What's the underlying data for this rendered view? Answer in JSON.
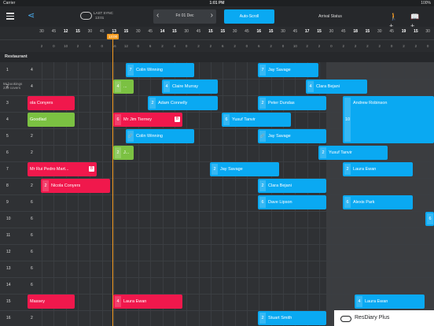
{
  "status_bar": {
    "carrier": "Carrier",
    "time": "1:01 PM",
    "battery": "100%"
  },
  "toolbar": {
    "sync_label": "LAST SYNC",
    "sync_time": "13:01",
    "date": "Fri 01 Dec",
    "autoscroll": "Auto-Scroll",
    "arrival": "Arrival Status"
  },
  "timeline": {
    "ticks": [
      "30",
      "45",
      "12",
      "15",
      "30",
      "45",
      "13",
      "15",
      "30",
      "45",
      "14",
      "15",
      "30",
      "45",
      "15",
      "15",
      "30",
      "45",
      "16",
      "15",
      "30",
      "45",
      "17",
      "15",
      "30",
      "45",
      "18",
      "15",
      "30",
      "45",
      "19",
      "15",
      "30",
      "45",
      "20"
    ],
    "counts": [
      "2",
      "0",
      "10",
      "2",
      "4",
      "0",
      "16",
      "12",
      "0",
      "6",
      "2",
      "4",
      "0",
      "2",
      "2",
      "6",
      "2",
      "0",
      "6",
      "2",
      "0",
      "10",
      "2",
      "2",
      "0",
      "2",
      "2",
      "2",
      "2",
      "0",
      "2",
      "2",
      "0",
      "2",
      "0"
    ],
    "now_label": "13:00"
  },
  "summary": {
    "bookings": "55 bookings",
    "covers": "239 covers"
  },
  "section": "Restaurant",
  "rows": [
    {
      "num": "1",
      "covers": "4"
    },
    {
      "num": "2",
      "covers": "4"
    },
    {
      "num": "3",
      "covers": "2"
    },
    {
      "num": "4",
      "covers": "2"
    },
    {
      "num": "5",
      "covers": "2"
    },
    {
      "num": "6",
      "covers": "2"
    },
    {
      "num": "7",
      "covers": "2"
    },
    {
      "num": "8",
      "covers": "2"
    },
    {
      "num": "9",
      "covers": "6"
    },
    {
      "num": "10",
      "covers": "6"
    },
    {
      "num": "11",
      "covers": "6"
    },
    {
      "num": "12",
      "covers": "6"
    },
    {
      "num": "13",
      "covers": "6"
    },
    {
      "num": "14",
      "covers": "6"
    },
    {
      "num": "15",
      "covers": "4"
    },
    {
      "num": "16",
      "covers": "2"
    }
  ],
  "bookings": [
    {
      "row": 0,
      "start": 160,
      "end": 247,
      "color": "blue",
      "covers": "7",
      "name": "Colin Winning"
    },
    {
      "row": 0,
      "start": 328,
      "end": 405,
      "color": "blue",
      "covers": "7",
      "name": "Jay Savage"
    },
    {
      "row": 1,
      "start": 144,
      "end": 170,
      "color": "green",
      "covers": "4",
      "name": "..."
    },
    {
      "row": 1,
      "start": 206,
      "end": 277,
      "color": "blue",
      "covers": "4",
      "name": "Claire Murray"
    },
    {
      "row": 1,
      "start": 389,
      "end": 467,
      "color": "blue",
      "covers": "4",
      "name": "Clara Bejani"
    },
    {
      "row": 2,
      "start": 35,
      "end": 95,
      "color": "red",
      "covers": "",
      "name": "ola Conyers"
    },
    {
      "row": 2,
      "start": 188,
      "end": 277,
      "color": "blue",
      "covers": "2",
      "name": "Adam Connelly"
    },
    {
      "row": 2,
      "start": 328,
      "end": 415,
      "color": "blue",
      "covers": "2",
      "name": "Peter Dundas"
    },
    {
      "row": 2,
      "start": 436,
      "end": 552,
      "color": "blue",
      "covers": "10",
      "name": "Andrew Robinson",
      "tall": true
    },
    {
      "row": 3,
      "start": 35,
      "end": 95,
      "color": "green",
      "covers": "",
      "name": "Goodlad"
    },
    {
      "row": 3,
      "start": 144,
      "end": 232,
      "color": "red",
      "covers": "6",
      "name": "Mr Jim Tierney",
      "badge": "B"
    },
    {
      "row": 3,
      "start": 282,
      "end": 370,
      "color": "blue",
      "covers": "6",
      "name": "Yusuf Tanvir"
    },
    {
      "row": 4,
      "start": 160,
      "end": 247,
      "color": "blue",
      "covers": "",
      "name": "Colin Winning",
      "link": true
    },
    {
      "row": 4,
      "start": 328,
      "end": 415,
      "color": "blue",
      "covers": "",
      "name": "Jay Savage",
      "link": true
    },
    {
      "row": 5,
      "start": 144,
      "end": 170,
      "color": "green",
      "covers": "2",
      "name": "J..."
    },
    {
      "row": 5,
      "start": 405,
      "end": 493,
      "color": "blue",
      "covers": "2",
      "name": "Yusuf Tanvir"
    },
    {
      "row": 6,
      "start": 35,
      "end": 123,
      "color": "red",
      "covers": "",
      "name": "Mr Rui Pedro  Mart...",
      "badge": "B"
    },
    {
      "row": 6,
      "start": 267,
      "end": 355,
      "color": "blue",
      "covers": "2",
      "name": "Jay Savage"
    },
    {
      "row": 6,
      "start": 436,
      "end": 525,
      "color": "blue",
      "covers": "2",
      "name": "Laura Ewan"
    },
    {
      "row": 7,
      "start": 52,
      "end": 140,
      "color": "red",
      "covers": "2",
      "name": "Nicola Conyers"
    },
    {
      "row": 7,
      "start": 328,
      "end": 415,
      "color": "blue",
      "covers": "2",
      "name": "Clara Bejani"
    },
    {
      "row": 8,
      "start": 328,
      "end": 415,
      "color": "blue",
      "covers": "6",
      "name": "Dave Lipson"
    },
    {
      "row": 8,
      "start": 436,
      "end": 525,
      "color": "blue",
      "covers": "6",
      "name": "Alexis Park"
    },
    {
      "row": 9,
      "start": 541,
      "end": 552,
      "color": "blue",
      "covers": "6",
      "name": ""
    },
    {
      "row": 14,
      "start": 35,
      "end": 95,
      "color": "red",
      "covers": "",
      "name": "Massey"
    },
    {
      "row": 14,
      "start": 144,
      "end": 232,
      "color": "red",
      "covers": "4",
      "name": "Laura Ewan"
    },
    {
      "row": 14,
      "start": 451,
      "end": 540,
      "color": "blue",
      "covers": "4",
      "name": "Laura Ewan"
    },
    {
      "row": 15,
      "start": 328,
      "end": 415,
      "color": "blue",
      "covers": "2",
      "name": "Stuart Smith"
    }
  ],
  "brand": "ResDiary Plus",
  "colors": {
    "accent": "#0aa9f2",
    "red": "#f0184c",
    "green": "#7bc142",
    "now": "#f59b20"
  }
}
